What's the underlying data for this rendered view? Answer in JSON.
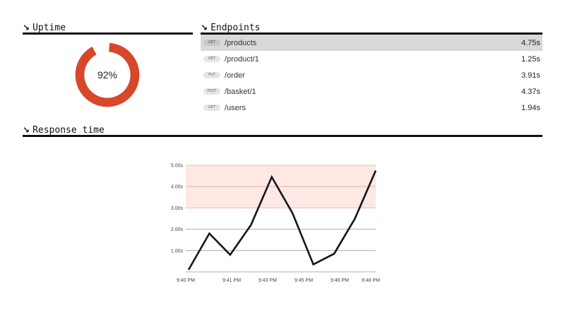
{
  "uptime": {
    "title": "Uptime",
    "value": 92,
    "value_label": "92%",
    "color": "#d9472b"
  },
  "endpoints": {
    "title": "Endpoints",
    "items": [
      {
        "method": "GET",
        "path": "/products",
        "time": "4.75s",
        "selected": true
      },
      {
        "method": "GET",
        "path": "/product/1",
        "time": "1.25s",
        "selected": false
      },
      {
        "method": "PUT",
        "path": "/order",
        "time": "3.91s",
        "selected": false
      },
      {
        "method": "POST",
        "path": "/basket/1",
        "time": "4.37s",
        "selected": false
      },
      {
        "method": "GET",
        "path": "/users",
        "time": "1.94s",
        "selected": false
      }
    ]
  },
  "response_time": {
    "title": "Response time"
  },
  "icons": {
    "section_arrow": "arrow-down-right-icon"
  },
  "colors": {
    "line": "#151520",
    "threshold_fill": "#fde8e3",
    "threshold_grid": "#e8a99b",
    "grid": "#9a9a9a"
  },
  "chart_data": {
    "type": "line",
    "x": [
      "9:40 PM",
      "9:41 PM",
      "9:42 PM",
      "9:42 PM",
      "9:43 PM",
      "9:44 PM",
      "9:45 PM",
      "9:45 PM",
      "9:46 PM",
      "9:47 PM",
      "9:48 PM"
    ],
    "x_tick_labels": [
      "9:40 PM",
      "9:41 PM",
      "9:43 PM",
      "9:45 PM",
      "9:46 PM",
      "9:48 PM"
    ],
    "series": [
      {
        "values": [
          0.1,
          1.8,
          0.8,
          2.2,
          4.45,
          2.75,
          0.35,
          0.85,
          2.5,
          4.75
        ]
      }
    ],
    "y_tick_labels": [
      "1.00s",
      "2.00s",
      "3.00s",
      "4.00s",
      "5.00s"
    ],
    "y_ticks": [
      1,
      2,
      3,
      4,
      5
    ],
    "ylim": [
      0,
      5
    ],
    "threshold_band": [
      3,
      5
    ],
    "grid": true
  }
}
